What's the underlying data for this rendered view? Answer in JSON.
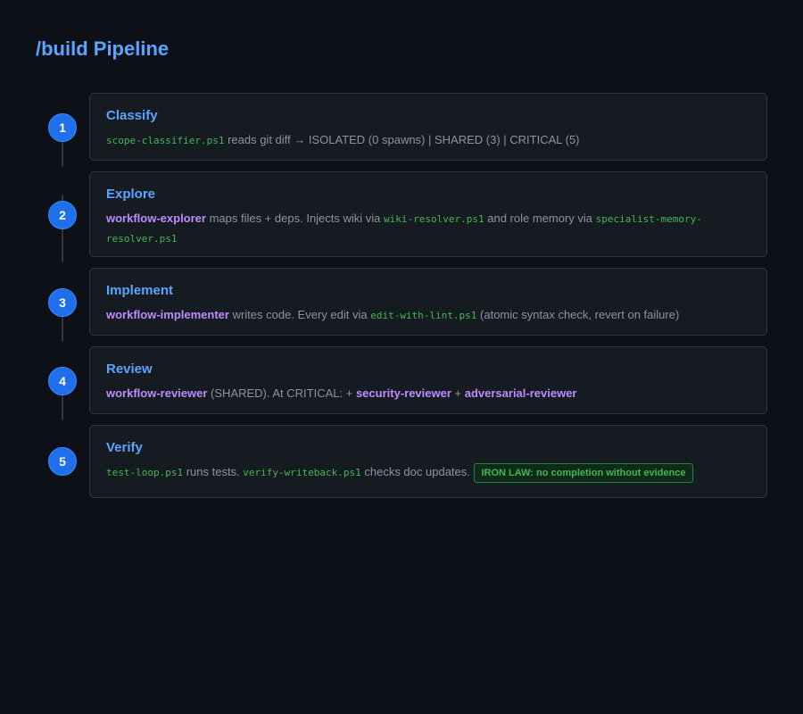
{
  "page": {
    "title": "/build Pipeline"
  },
  "steps": [
    {
      "number": "1",
      "title": "Classify",
      "parts": [
        {
          "type": "code",
          "text": "scope-classifier.ps1"
        },
        {
          "type": "text",
          "text": " reads git diff → ISOLATED (0 spawns) | SHARED (3) | CRITICAL (5)"
        }
      ]
    },
    {
      "number": "2",
      "title": "Explore",
      "parts": [
        {
          "type": "agent",
          "text": "workflow-explorer"
        },
        {
          "type": "text",
          "text": " maps files + deps. Injects wiki via "
        },
        {
          "type": "code",
          "text": "wiki-resolver.ps1"
        },
        {
          "type": "text",
          "text": " and role memory via "
        },
        {
          "type": "code",
          "text": "specialist-memory-resolver.ps1"
        }
      ]
    },
    {
      "number": "3",
      "title": "Implement",
      "parts": [
        {
          "type": "agent",
          "text": "workflow-implementer"
        },
        {
          "type": "text",
          "text": " writes code. Every edit via "
        },
        {
          "type": "code",
          "text": "edit-with-lint.ps1"
        },
        {
          "type": "text",
          "text": " (atomic syntax check, revert on failure)"
        }
      ]
    },
    {
      "number": "4",
      "title": "Review",
      "parts": [
        {
          "type": "agent",
          "text": "workflow-reviewer"
        },
        {
          "type": "text",
          "text": " (SHARED). At CRITICAL: + "
        },
        {
          "type": "agent",
          "text": "security-reviewer"
        },
        {
          "type": "text",
          "text": " + "
        },
        {
          "type": "agent",
          "text": "adversarial-reviewer"
        }
      ]
    },
    {
      "number": "5",
      "title": "Verify",
      "parts": [
        {
          "type": "code",
          "text": "test-loop.ps1"
        },
        {
          "type": "text",
          "text": " runs tests. "
        },
        {
          "type": "code",
          "text": "verify-writeback.ps1"
        },
        {
          "type": "text",
          "text": " checks doc updates. "
        },
        {
          "type": "badge",
          "text": "IRON LAW: no completion without evidence"
        }
      ]
    }
  ]
}
